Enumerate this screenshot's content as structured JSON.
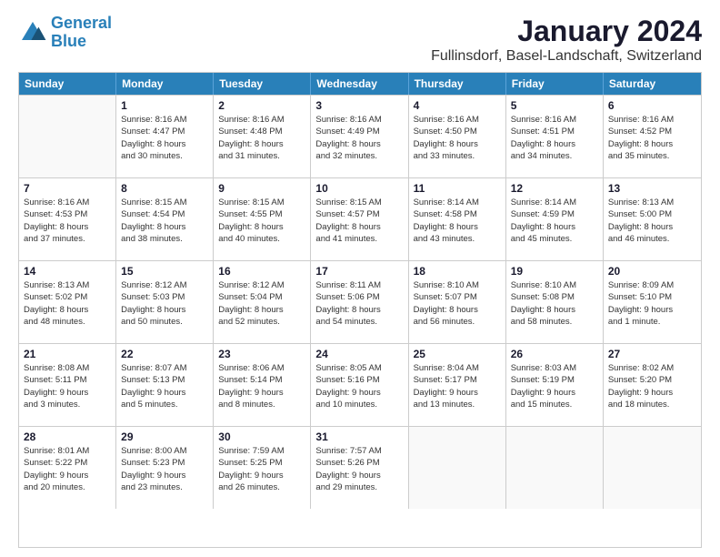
{
  "logo": {
    "line1": "General",
    "line2": "Blue"
  },
  "title": "January 2024",
  "subtitle": "Fullinsdorf, Basel-Landschaft, Switzerland",
  "header": {
    "days": [
      "Sunday",
      "Monday",
      "Tuesday",
      "Wednesday",
      "Thursday",
      "Friday",
      "Saturday"
    ]
  },
  "weeks": [
    [
      {
        "day": "",
        "info": ""
      },
      {
        "day": "1",
        "info": "Sunrise: 8:16 AM\nSunset: 4:47 PM\nDaylight: 8 hours\nand 30 minutes."
      },
      {
        "day": "2",
        "info": "Sunrise: 8:16 AM\nSunset: 4:48 PM\nDaylight: 8 hours\nand 31 minutes."
      },
      {
        "day": "3",
        "info": "Sunrise: 8:16 AM\nSunset: 4:49 PM\nDaylight: 8 hours\nand 32 minutes."
      },
      {
        "day": "4",
        "info": "Sunrise: 8:16 AM\nSunset: 4:50 PM\nDaylight: 8 hours\nand 33 minutes."
      },
      {
        "day": "5",
        "info": "Sunrise: 8:16 AM\nSunset: 4:51 PM\nDaylight: 8 hours\nand 34 minutes."
      },
      {
        "day": "6",
        "info": "Sunrise: 8:16 AM\nSunset: 4:52 PM\nDaylight: 8 hours\nand 35 minutes."
      }
    ],
    [
      {
        "day": "7",
        "info": "Sunrise: 8:16 AM\nSunset: 4:53 PM\nDaylight: 8 hours\nand 37 minutes."
      },
      {
        "day": "8",
        "info": "Sunrise: 8:15 AM\nSunset: 4:54 PM\nDaylight: 8 hours\nand 38 minutes."
      },
      {
        "day": "9",
        "info": "Sunrise: 8:15 AM\nSunset: 4:55 PM\nDaylight: 8 hours\nand 40 minutes."
      },
      {
        "day": "10",
        "info": "Sunrise: 8:15 AM\nSunset: 4:57 PM\nDaylight: 8 hours\nand 41 minutes."
      },
      {
        "day": "11",
        "info": "Sunrise: 8:14 AM\nSunset: 4:58 PM\nDaylight: 8 hours\nand 43 minutes."
      },
      {
        "day": "12",
        "info": "Sunrise: 8:14 AM\nSunset: 4:59 PM\nDaylight: 8 hours\nand 45 minutes."
      },
      {
        "day": "13",
        "info": "Sunrise: 8:13 AM\nSunset: 5:00 PM\nDaylight: 8 hours\nand 46 minutes."
      }
    ],
    [
      {
        "day": "14",
        "info": "Sunrise: 8:13 AM\nSunset: 5:02 PM\nDaylight: 8 hours\nand 48 minutes."
      },
      {
        "day": "15",
        "info": "Sunrise: 8:12 AM\nSunset: 5:03 PM\nDaylight: 8 hours\nand 50 minutes."
      },
      {
        "day": "16",
        "info": "Sunrise: 8:12 AM\nSunset: 5:04 PM\nDaylight: 8 hours\nand 52 minutes."
      },
      {
        "day": "17",
        "info": "Sunrise: 8:11 AM\nSunset: 5:06 PM\nDaylight: 8 hours\nand 54 minutes."
      },
      {
        "day": "18",
        "info": "Sunrise: 8:10 AM\nSunset: 5:07 PM\nDaylight: 8 hours\nand 56 minutes."
      },
      {
        "day": "19",
        "info": "Sunrise: 8:10 AM\nSunset: 5:08 PM\nDaylight: 8 hours\nand 58 minutes."
      },
      {
        "day": "20",
        "info": "Sunrise: 8:09 AM\nSunset: 5:10 PM\nDaylight: 9 hours\nand 1 minute."
      }
    ],
    [
      {
        "day": "21",
        "info": "Sunrise: 8:08 AM\nSunset: 5:11 PM\nDaylight: 9 hours\nand 3 minutes."
      },
      {
        "day": "22",
        "info": "Sunrise: 8:07 AM\nSunset: 5:13 PM\nDaylight: 9 hours\nand 5 minutes."
      },
      {
        "day": "23",
        "info": "Sunrise: 8:06 AM\nSunset: 5:14 PM\nDaylight: 9 hours\nand 8 minutes."
      },
      {
        "day": "24",
        "info": "Sunrise: 8:05 AM\nSunset: 5:16 PM\nDaylight: 9 hours\nand 10 minutes."
      },
      {
        "day": "25",
        "info": "Sunrise: 8:04 AM\nSunset: 5:17 PM\nDaylight: 9 hours\nand 13 minutes."
      },
      {
        "day": "26",
        "info": "Sunrise: 8:03 AM\nSunset: 5:19 PM\nDaylight: 9 hours\nand 15 minutes."
      },
      {
        "day": "27",
        "info": "Sunrise: 8:02 AM\nSunset: 5:20 PM\nDaylight: 9 hours\nand 18 minutes."
      }
    ],
    [
      {
        "day": "28",
        "info": "Sunrise: 8:01 AM\nSunset: 5:22 PM\nDaylight: 9 hours\nand 20 minutes."
      },
      {
        "day": "29",
        "info": "Sunrise: 8:00 AM\nSunset: 5:23 PM\nDaylight: 9 hours\nand 23 minutes."
      },
      {
        "day": "30",
        "info": "Sunrise: 7:59 AM\nSunset: 5:25 PM\nDaylight: 9 hours\nand 26 minutes."
      },
      {
        "day": "31",
        "info": "Sunrise: 7:57 AM\nSunset: 5:26 PM\nDaylight: 9 hours\nand 29 minutes."
      },
      {
        "day": "",
        "info": ""
      },
      {
        "day": "",
        "info": ""
      },
      {
        "day": "",
        "info": ""
      }
    ]
  ]
}
